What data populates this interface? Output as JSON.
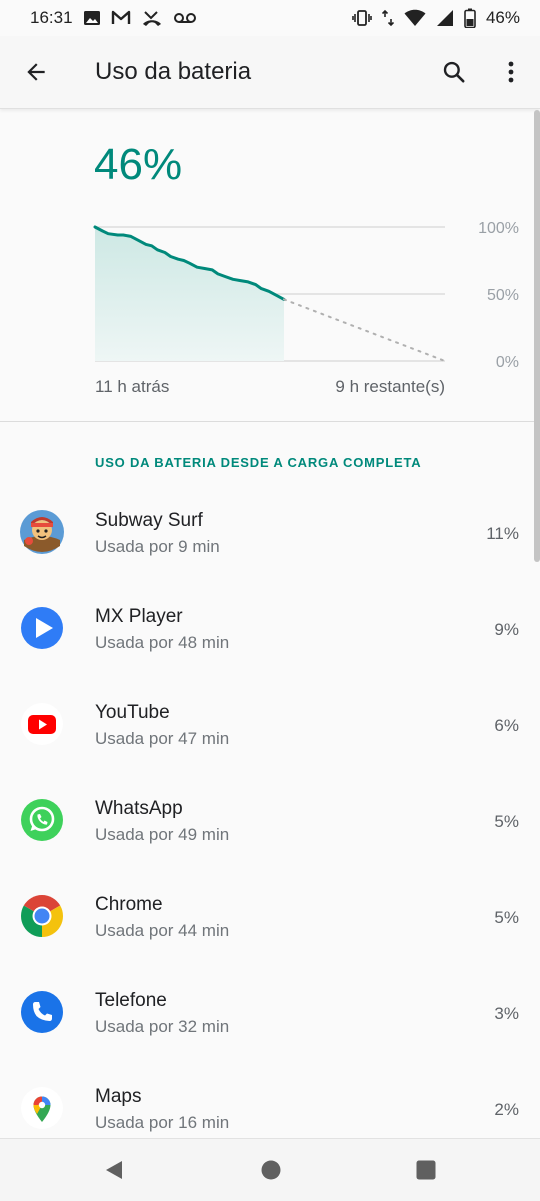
{
  "status_bar": {
    "time": "16:31",
    "battery_percent": "46%",
    "left_icons": [
      "image-icon",
      "gmail-icon",
      "missed-call-icon",
      "voicemail-icon"
    ],
    "right_icons": [
      "vibrate-icon",
      "data-arrows-icon",
      "wifi-icon",
      "signal-icon",
      "battery-icon"
    ]
  },
  "app_bar": {
    "title": "Uso da bateria",
    "back_icon": "arrow-back-icon",
    "search_icon": "search-icon",
    "more_icon": "more-vert-icon"
  },
  "battery": {
    "level": "46%",
    "time_ago": "11 h atrás",
    "time_remaining": "9 h restante(s)"
  },
  "chart_data": {
    "type": "line",
    "y_ticks": [
      "100%",
      "50%",
      "0%"
    ],
    "ylim": [
      0,
      100
    ],
    "x_start_label": "11 h atrás",
    "x_end_label": "9 h restante(s)",
    "history": {
      "x_fraction": [
        0,
        0.04,
        0.07,
        0.12,
        0.15,
        0.19,
        0.23,
        0.27,
        0.3,
        0.33,
        0.37,
        0.4,
        0.44,
        0.47,
        0.5,
        0.54,
        0.58,
        0.62,
        0.65,
        0.69,
        0.73,
        0.77,
        0.81,
        0.85,
        0.88,
        0.92,
        0.96,
        1.0
      ],
      "level": [
        100,
        97,
        95,
        94,
        94,
        93,
        90,
        87,
        86,
        83,
        81,
        78,
        76,
        75,
        73,
        70,
        69,
        68,
        65,
        63,
        61,
        60,
        59,
        57,
        54,
        52,
        49,
        46
      ]
    },
    "history_portion": 0.54,
    "projection_end_level": 0,
    "line_color": "#00897b",
    "fill_color": "#cde8e4",
    "grid": true
  },
  "section": {
    "header": "USO DA BATERIA DESDE A CARGA COMPLETA"
  },
  "apps": [
    {
      "name": "Subway Surf",
      "usage": "Usada por 9 min",
      "percent": "11%",
      "icon": "subway-surf-icon"
    },
    {
      "name": "MX Player",
      "usage": "Usada por 48 min",
      "percent": "9%",
      "icon": "mx-player-icon"
    },
    {
      "name": "YouTube",
      "usage": "Usada por 47 min",
      "percent": "6%",
      "icon": "youtube-icon"
    },
    {
      "name": "WhatsApp",
      "usage": "Usada por 49 min",
      "percent": "5%",
      "icon": "whatsapp-icon"
    },
    {
      "name": "Chrome",
      "usage": "Usada por 44 min",
      "percent": "5%",
      "icon": "chrome-icon"
    },
    {
      "name": "Telefone",
      "usage": "Usada por 32 min",
      "percent": "3%",
      "icon": "phone-icon"
    },
    {
      "name": "Maps",
      "usage": "Usada por 16 min",
      "percent": "2%",
      "icon": "maps-icon"
    }
  ],
  "nav_bar": {
    "icons": [
      "nav-back-icon",
      "nav-home-icon",
      "nav-recents-icon"
    ]
  },
  "colors": {
    "accent": "#00897b",
    "background": "#fafafa"
  }
}
